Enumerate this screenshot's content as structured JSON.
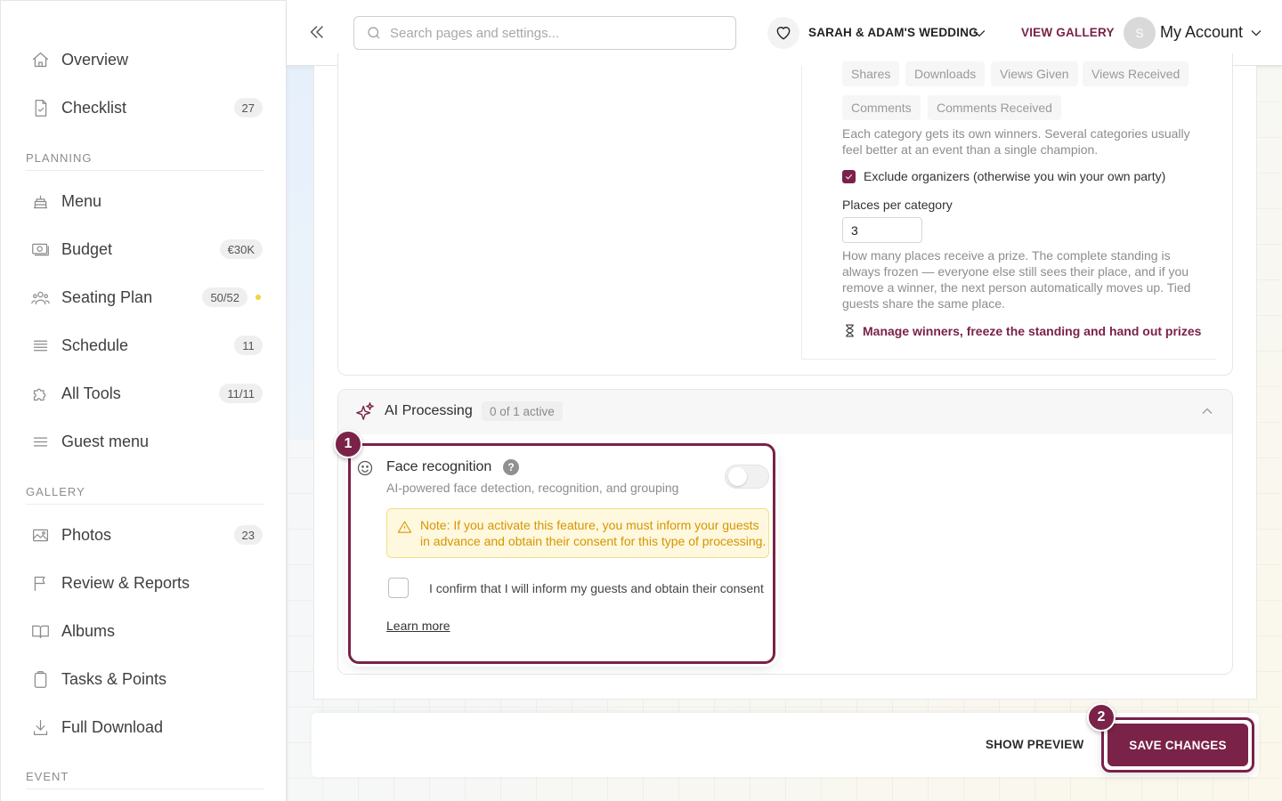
{
  "sidebar": {
    "items": [
      {
        "label": "Overview",
        "badge": ""
      },
      {
        "label": "Checklist",
        "badge": "27"
      },
      {
        "label": "Menu",
        "badge": ""
      },
      {
        "label": "Budget",
        "badge": "€30K"
      },
      {
        "label": "Seating Plan",
        "badge": "50/52"
      },
      {
        "label": "Schedule",
        "badge": "11"
      },
      {
        "label": "All Tools",
        "badge": "11/11"
      },
      {
        "label": "Guest menu",
        "badge": ""
      },
      {
        "label": "Photos",
        "badge": "23"
      },
      {
        "label": "Review & Reports",
        "badge": ""
      },
      {
        "label": "Albums",
        "badge": ""
      },
      {
        "label": "Tasks & Points",
        "badge": ""
      },
      {
        "label": "Full Download",
        "badge": ""
      }
    ],
    "sections": {
      "planning": "PLANNING",
      "gallery": "GALLERY",
      "event": "EVENT"
    },
    "status_dot_color": "#f2d53c"
  },
  "header": {
    "search_placeholder": "Search pages and settings...",
    "event_name": "SARAH & ADAM'S WEDDING",
    "view_gallery": "VIEW GALLERY",
    "avatar_initial": "S",
    "account_label": "My Account"
  },
  "ranking": {
    "chips": [
      "Shares",
      "Downloads",
      "Views Given",
      "Views Received",
      "Comments",
      "Comments Received"
    ],
    "categories_help": "Each category gets its own winners. Several categories usually feel better at an event than a single champion.",
    "exclude_label": "Exclude organizers (otherwise you win your own party)",
    "exclude_checked": true,
    "places_label": "Places per category",
    "places_value": "3",
    "places_help": "How many places receive a prize. The complete standing is always frozen — everyone else still sees their place, and if you remove a winner, the next person automatically moves up. Tied guests share the same place.",
    "manage_link": "Manage winners, freeze the standing and hand out prizes"
  },
  "ai_processing": {
    "title": "AI Processing",
    "count": "0 of 1 active",
    "face": {
      "title": "Face recognition",
      "help": "?",
      "subtitle": "AI-powered face detection, recognition, and grouping",
      "enabled": false,
      "warning": "Note: If you activate this feature, you must inform your guests in advance and obtain their consent for this type of processing.",
      "consent_label": "I confirm that I will inform my guests and obtain their consent",
      "learn_more": "Learn more"
    }
  },
  "steps": {
    "one": "1",
    "two": "2"
  },
  "footer": {
    "show_preview": "SHOW PREVIEW",
    "save": "SAVE CHANGES"
  },
  "colors": {
    "brand": "#7a2248",
    "warning": "#d89500"
  }
}
